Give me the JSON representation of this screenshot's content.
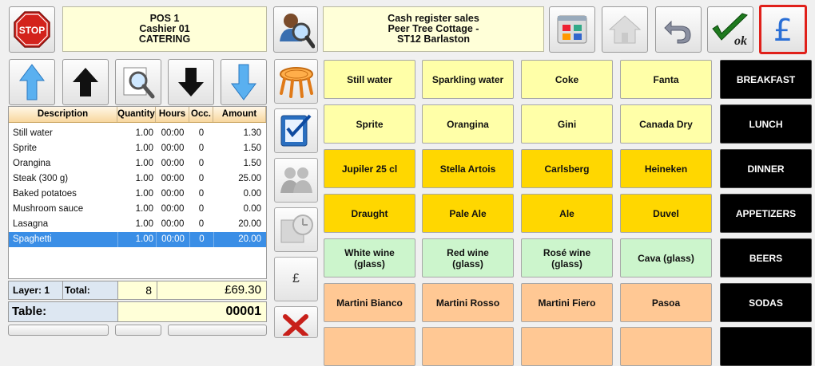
{
  "header": {
    "pos_lines": [
      "POS 1",
      "Cashier 01",
      "CATERING"
    ],
    "store_lines": [
      "Cash register sales",
      "Peer Tree Cottage -",
      "ST12 Barlaston"
    ],
    "currency_symbol": "£"
  },
  "table": {
    "columns": [
      "Description",
      "Quantity",
      "Hours",
      "Occ.",
      "Amount"
    ],
    "rows": [
      {
        "desc": "Still water",
        "qty": "1.00",
        "hours": "00:00",
        "occ": "0",
        "amount": "1.30"
      },
      {
        "desc": "Sprite",
        "qty": "1.00",
        "hours": "00:00",
        "occ": "0",
        "amount": "1.50"
      },
      {
        "desc": "Orangina",
        "qty": "1.00",
        "hours": "00:00",
        "occ": "0",
        "amount": "1.50"
      },
      {
        "desc": "Steak (300 g)",
        "qty": "1.00",
        "hours": "00:00",
        "occ": "0",
        "amount": "25.00"
      },
      {
        "desc": "Baked potatoes",
        "qty": "1.00",
        "hours": "00:00",
        "occ": "0",
        "amount": "0.00"
      },
      {
        "desc": "Mushroom sauce",
        "qty": "1.00",
        "hours": "00:00",
        "occ": "0",
        "amount": "0.00"
      },
      {
        "desc": "Lasagna",
        "qty": "1.00",
        "hours": "00:00",
        "occ": "0",
        "amount": "20.00"
      },
      {
        "desc": "Spaghetti",
        "qty": "1.00",
        "hours": "00:00",
        "occ": "0",
        "amount": "20.00"
      }
    ],
    "selected_index": 7
  },
  "totals": {
    "layer_label": "Layer: 1",
    "total_label": "Total:",
    "count": "8",
    "amount": "£69.30",
    "table_label": "Table:",
    "table_number": "00001"
  },
  "products": [
    {
      "label": "Still water",
      "color": "#ffffa8"
    },
    {
      "label": "Sparkling water",
      "color": "#ffffa8"
    },
    {
      "label": "Coke",
      "color": "#ffffa8"
    },
    {
      "label": "Fanta",
      "color": "#ffffa8"
    },
    {
      "label": "Sprite",
      "color": "#ffffa8"
    },
    {
      "label": "Orangina",
      "color": "#ffffa8"
    },
    {
      "label": "Gini",
      "color": "#ffffa8"
    },
    {
      "label": "Canada Dry",
      "color": "#ffffa8"
    },
    {
      "label": "Jupiler 25 cl",
      "color": "#ffd700"
    },
    {
      "label": "Stella Artois",
      "color": "#ffd700"
    },
    {
      "label": "Carlsberg",
      "color": "#ffd700"
    },
    {
      "label": "Heineken",
      "color": "#ffd700"
    },
    {
      "label": "Draught",
      "color": "#ffd700"
    },
    {
      "label": "Pale Ale",
      "color": "#ffd700"
    },
    {
      "label": "Ale",
      "color": "#ffd700"
    },
    {
      "label": "Duvel",
      "color": "#ffd700"
    },
    {
      "label": "White wine\n(glass)",
      "color": "#ccf5cc"
    },
    {
      "label": "Red wine\n(glass)",
      "color": "#ccf5cc"
    },
    {
      "label": "Rosé wine\n(glass)",
      "color": "#ccf5cc"
    },
    {
      "label": "Cava (glass)",
      "color": "#ccf5cc"
    },
    {
      "label": "Martini Bianco",
      "color": "#ffc894"
    },
    {
      "label": "Martini Rosso",
      "color": "#ffc894"
    },
    {
      "label": "Martini Fiero",
      "color": "#ffc894"
    },
    {
      "label": "Pasoa",
      "color": "#ffc894"
    }
  ],
  "categories": [
    "BREAKFAST",
    "LUNCH",
    "DINNER",
    "APPETIZERS",
    "BEERS",
    "SODAS"
  ],
  "side_buttons": {
    "currency_label": "£"
  },
  "icons": {
    "stop": "stop-sign-icon",
    "search_user": "user-search-icon",
    "layout": "layout-grid-icon",
    "home": "home-icon",
    "undo": "undo-icon",
    "ok": "ok-check-icon",
    "pay": "pound-pay-icon"
  }
}
